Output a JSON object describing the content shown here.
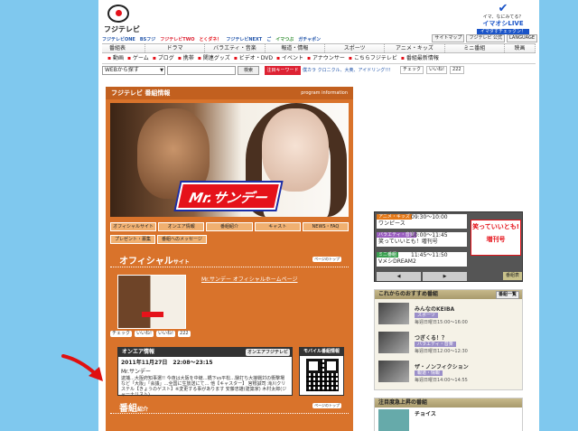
{
  "header": {
    "logo_text": "フジテレビ",
    "live": {
      "brand": "LIVE",
      "line1": "イマ、なにみてる？",
      "line2": "イマオシLIVE",
      "line3": "イマダすチェックン！"
    },
    "channels": [
      "フジテレビONE",
      "BSフジ",
      "フジテレビTWO",
      "とくダネ！",
      "フジテレビNEXT",
      "ご",
      "イマつぶ",
      "ガチャポン"
    ],
    "utility_links": [
      "サイトマップ",
      "フジテレビ 公式",
      "LANGUAGE"
    ],
    "global_nav": [
      "番組表",
      "ドラマ",
      "バラエティ・音楽",
      "報道・情報",
      "スポーツ",
      "アニメ・キッズ",
      "ミニ番組",
      "映画"
    ],
    "sub_nav": [
      "動画",
      "ゲーム",
      "ブログ",
      "携帯",
      "関連グッズ",
      "ビデオ・DVD",
      "イベント",
      "アナウンサー",
      "こちらフジテレビ",
      "番組最新情報"
    ],
    "search": {
      "select": "WEBから探す",
      "placeholder": "",
      "button": "検索",
      "keyword_tag": "注目キーワード",
      "keyword_links": "僕カラ クロニクル、大奥、アイドリング!!!"
    },
    "social": {
      "check": "チェック",
      "iine": "いいね!",
      "count": "222"
    }
  },
  "main": {
    "section_title": "フジテレビ 番組情報",
    "section_en": "program information",
    "hero_title": "Mr.サンデー",
    "tabs_row1": [
      "オフィシャルサイト",
      "オンエア情報",
      "番組紹介",
      "キャスト",
      "NEWS・FAQ"
    ],
    "tabs_row2": [
      "プレゼント・募集",
      "番組へのメッセージ"
    ],
    "official": {
      "title_big": "オフィシャル",
      "title_small": "サイト",
      "top_button": "ページのトップ",
      "link": "Mr.サンデー オフィシャルホームページ"
    },
    "social_row": {
      "check": "チェック",
      "iine": "いいね!",
      "iine2": "いいね!",
      "count": "222"
    },
    "onair": {
      "header": "オンエア情報",
      "button": "オンエアフジテレビ",
      "date": "2011年11月27日　22:08～23:15",
      "title": "Mr.サンデー",
      "desc": "逮捕…大阪府知事選!! 今夜は大阪を中継…橋下vs平松…験打ち大接戦対の衝撃場など「大阪」「会議」…全国に生放送にて… 他【キャスター】 宮根誠司 滝川クリステル【きょうのゲスト】※変更する事があります 安藤忠雄(建築家) 木村太郎(ジャーナリスト)"
    },
    "qr": {
      "header": "モバイル番組情報"
    },
    "intro": {
      "title_big": "番組",
      "title_small": "紹介",
      "top_button": "ページのトップ"
    }
  },
  "sidebar": {
    "tv": [
      {
        "cat": "アニメ・キッズ",
        "time": "09:30～10:00",
        "name": "ワンピース",
        "color": "#e57a1a"
      },
      {
        "cat": "バラエティ・音楽",
        "time": "10:00～11:45",
        "name": "笑っていいとも！増刊号",
        "color": "#9b5fc0"
      },
      {
        "cat": "ミニ番組",
        "time": "11:45～11:50",
        "name": "VメシDREAM2",
        "color": "#3aa050"
      }
    ],
    "tv_logo": "笑っていいとも!増刊号",
    "tv_list": "番組表",
    "reco": {
      "header": "これからのおすすめ番組",
      "button": "番組一覧",
      "items": [
        {
          "name": "みんなのKEIBA",
          "tag": "スポーツ",
          "time": "毎週日曜日15:00～16:00"
        },
        {
          "name": "つぎくる！？",
          "tag": "バラエティ・音楽",
          "time": "毎週日曜日12:00～12:30"
        },
        {
          "name": "ザ・ノンフィクション",
          "tag": "報道・情報",
          "time": "毎週日曜日14:00～14:55"
        }
      ]
    },
    "attention": {
      "header": "注目度急上昇の番組",
      "item": "チョイス"
    }
  }
}
